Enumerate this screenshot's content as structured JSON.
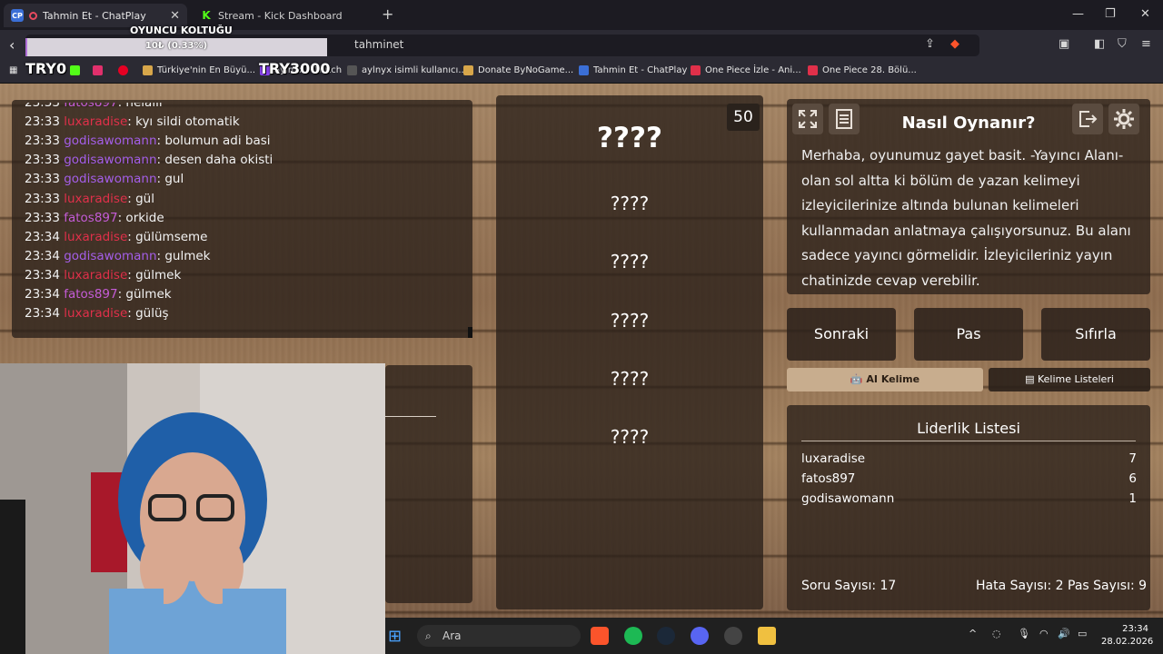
{
  "browser": {
    "tabs": [
      {
        "favicon": "CP",
        "title": "Tahmin Et - ChatPlay",
        "active": true
      },
      {
        "favicon": "K",
        "title": "Stream - Kick Dashboard",
        "active": false
      }
    ],
    "url_fragment": "tahminet",
    "bookmarks": [
      {
        "label": "Türkiye'nin En Büyü..."
      },
      {
        "label": "aylnyx - Twitch"
      },
      {
        "label": "aylnyx isimli kullanıcı..."
      },
      {
        "label": "Donate ByNoGame..."
      },
      {
        "label": "Tahmin Et - ChatPlay"
      },
      {
        "label": "One Piece İzle - Ani..."
      },
      {
        "label": "One Piece 28. Bölü..."
      }
    ]
  },
  "overlay": {
    "title": "OYUNCU KOLTUĞU",
    "progress_text": "10₺ (0.33%)",
    "progress_fraction": 0.0033,
    "label_left": "TRY0",
    "label_right": "TRY3000"
  },
  "chat": {
    "messages": [
      {
        "time": "23:33",
        "user": "fatos897",
        "color": "#c45cd6",
        "text": ": helalll"
      },
      {
        "time": "23:33",
        "user": "luxaradise",
        "color": "#e0304a",
        "text": ": kyı sildi otomatik"
      },
      {
        "time": "23:33",
        "user": "godisawomann",
        "color": "#a45ee8",
        "text": ": bolumun adi basi"
      },
      {
        "time": "23:33",
        "user": "godisawomann",
        "color": "#a45ee8",
        "text": ": desen daha okisti"
      },
      {
        "time": "23:33",
        "user": "godisawomann",
        "color": "#a45ee8",
        "text": ": gul"
      },
      {
        "time": "23:33",
        "user": "luxaradise",
        "color": "#e0304a",
        "text": ": gül"
      },
      {
        "time": "23:33",
        "user": "fatos897",
        "color": "#c45cd6",
        "text": ": orkide"
      },
      {
        "time": "23:34",
        "user": "luxaradise",
        "color": "#e0304a",
        "text": ": gülümseme"
      },
      {
        "time": "23:34",
        "user": "godisawomann",
        "color": "#a45ee8",
        "text": ": gulmek"
      },
      {
        "time": "23:34",
        "user": "luxaradise",
        "color": "#e0304a",
        "text": ": gülmek"
      },
      {
        "time": "23:34",
        "user": "fatos897",
        "color": "#c45cd6",
        "text": ": gülmek"
      },
      {
        "time": "23:34",
        "user": "luxaradise",
        "color": "#e0304a",
        "text": ": gülüş"
      }
    ]
  },
  "game": {
    "score": "50",
    "main_word": "????",
    "forbidden_words": [
      "????",
      "????",
      "????",
      "????",
      "????"
    ],
    "help_title": "Nasıl Oynanır?",
    "help_text": "Merhaba, oyunumuz gayet basit. -Yayıncı Alanı- olan sol altta ki bölüm de yazan kelimeyi izleyicilerinize altında bulunan kelimeleri kullanmadan anlatmaya çalışıyorsunuz. Bu alanı sadece yayıncı görmelidir. İzleyicileriniz yayın chatinizde cevap verebilir.",
    "buttons": {
      "next": "Sonraki",
      "pass": "Pas",
      "reset": "Sıfırla"
    },
    "tabs": {
      "ai": "AI Kelime",
      "lists": "Kelime Listeleri"
    },
    "leaderboard": {
      "title": "Liderlik Listesi",
      "rows": [
        {
          "name": "luxaradise",
          "score": "7"
        },
        {
          "name": "fatos897",
          "score": "6"
        },
        {
          "name": "godisawomann",
          "score": "1"
        }
      ],
      "question_count": "Soru Sayısı: 17",
      "error_count": "Hata Sayısı: 2",
      "pass_count": "Pas Sayısı: 9"
    }
  },
  "taskbar": {
    "search_placeholder": "Ara",
    "time": "23:34",
    "date": "28.02.2026"
  },
  "icons": {
    "fullscreen": "fullscreen-icon",
    "notes": "notes-icon",
    "exit": "exit-icon",
    "settings": "gear-icon"
  }
}
